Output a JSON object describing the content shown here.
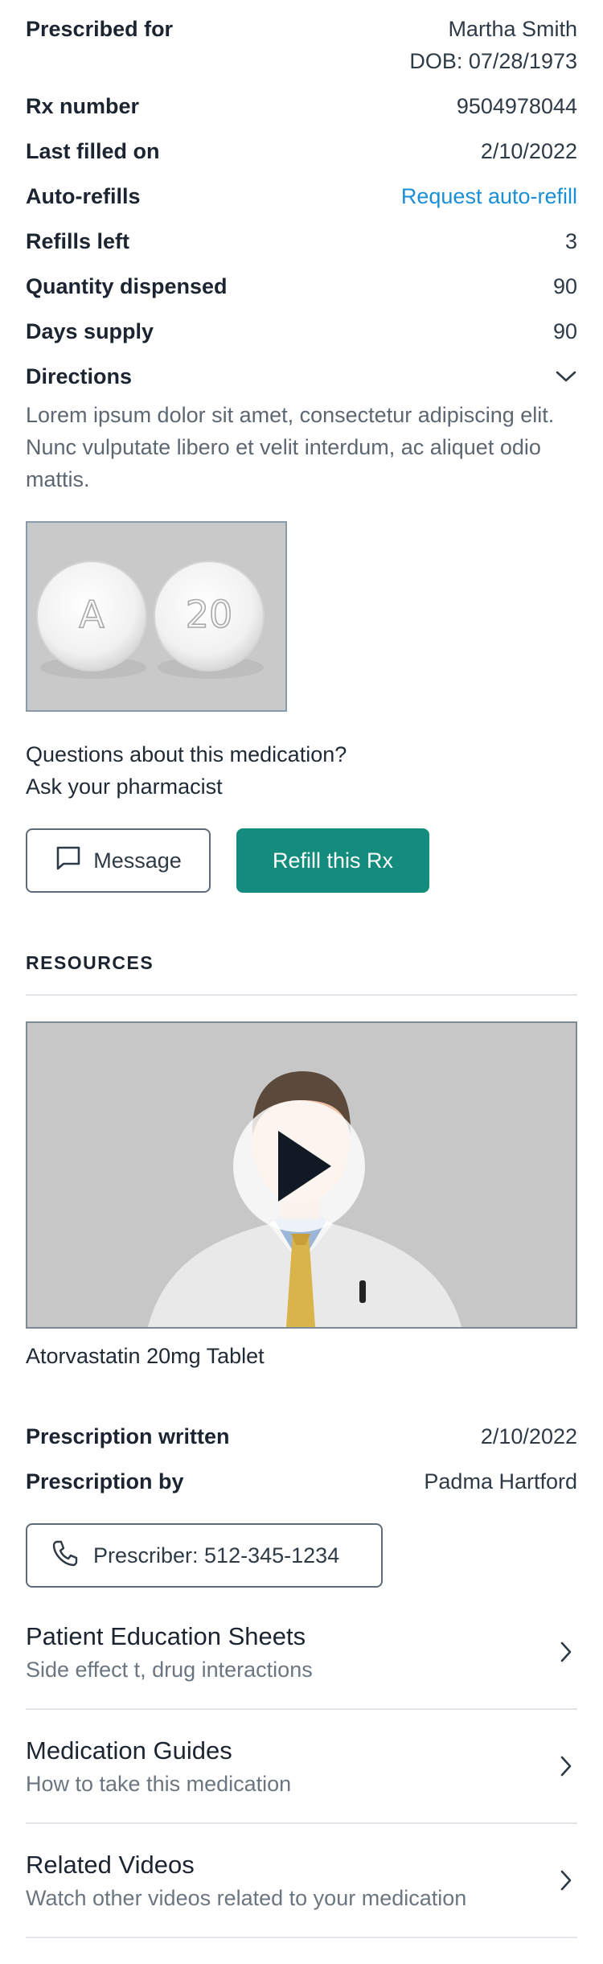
{
  "details": {
    "prescribed_for_label": "Prescribed for",
    "patient_name": "Martha Smith",
    "patient_dob": "DOB: 07/28/1973",
    "rx_number_label": "Rx number",
    "rx_number": "9504978044",
    "last_filled_label": "Last filled on",
    "last_filled": "2/10/2022",
    "auto_refills_label": "Auto-refills",
    "auto_refills_link": "Request auto-refill",
    "refills_left_label": "Refills left",
    "refills_left": "3",
    "quantity_label": "Quantity dispensed",
    "quantity": "90",
    "days_supply_label": "Days supply",
    "days_supply": "90",
    "directions_label": "Directions",
    "directions_text": "Lorem ipsum dolor sit amet, consectetur adipiscing elit. Nunc vulputate libero et velit interdum, ac aliquet odio mattis."
  },
  "pill_image": {
    "imprint_left": "A",
    "imprint_right": "20"
  },
  "questions": {
    "line1": "Questions about this medication?",
    "line2": "Ask your pharmacist"
  },
  "actions": {
    "message_label": "Message",
    "refill_label": "Refill this Rx"
  },
  "resources": {
    "title": "RESOURCES",
    "video_caption": "Atorvastatin 20mg Tablet"
  },
  "prescription": {
    "written_label": "Prescription written",
    "written_date": "2/10/2022",
    "by_label": "Prescription by",
    "by_name": "Padma Hartford",
    "prescriber_button": "Prescriber: 512-345-1234"
  },
  "links": [
    {
      "title": "Patient Education Sheets",
      "subtitle": "Side effect t, drug interactions"
    },
    {
      "title": "Medication Guides",
      "subtitle": "How to take this medication"
    },
    {
      "title": "Related Videos",
      "subtitle": "Watch other videos related to your medication"
    }
  ],
  "colors": {
    "accent_teal": "#148c7d",
    "link_blue": "#1a8fd6",
    "text_dark": "#1b2430"
  }
}
